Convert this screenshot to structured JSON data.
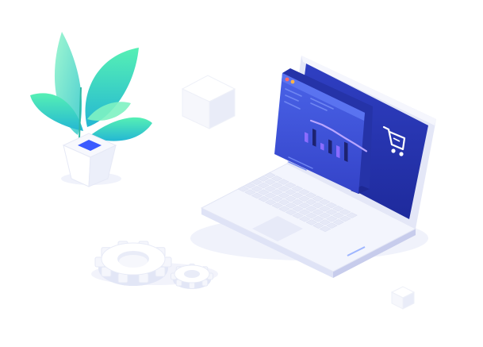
{
  "illustration": {
    "elements": [
      "plant-in-pot",
      "floating-cube-large",
      "laptop",
      "chart-window",
      "line-chart",
      "bar-chart",
      "shopping-cart-icon",
      "gear-large",
      "gear-small",
      "floating-cube-small"
    ]
  },
  "colors": {
    "screen_blue": "#2d3bb8",
    "screen_blue_dark": "#1e2a9c",
    "window_blue": "#3a4fd6",
    "chart_line": "#b9a6ff",
    "leaf_green": "#3fe0b0",
    "leaf_teal": "#2bc6c9",
    "pot_square": "#3b5bff",
    "light_surface": "#eef0fb",
    "shadow": "#e3e6f5"
  },
  "line_chart": {
    "values": [
      0.55,
      0.62,
      0.58,
      0.48,
      0.4,
      0.3
    ]
  },
  "bar_chart": {
    "values": [
      0.45,
      0.8,
      0.3,
      0.65,
      0.55,
      0.9
    ]
  }
}
